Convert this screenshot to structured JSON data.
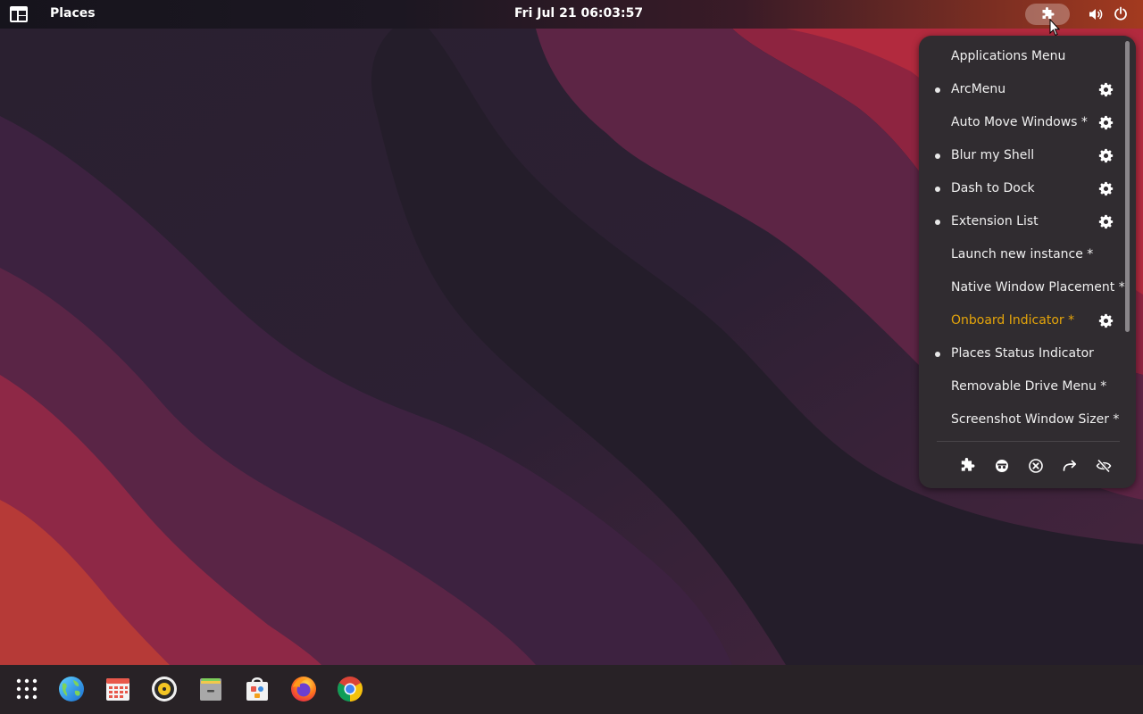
{
  "topbar": {
    "places_label": "Places",
    "clock": "Fri Jul 21  06:03:57"
  },
  "extension_menu": {
    "items": [
      {
        "label": "Applications Menu",
        "enabled": false,
        "has_settings": false,
        "highlight": false
      },
      {
        "label": "ArcMenu",
        "enabled": true,
        "has_settings": true,
        "highlight": false
      },
      {
        "label": "Auto Move Windows *",
        "enabled": false,
        "has_settings": true,
        "highlight": false
      },
      {
        "label": "Blur my Shell",
        "enabled": true,
        "has_settings": true,
        "highlight": false
      },
      {
        "label": "Dash to Dock",
        "enabled": true,
        "has_settings": true,
        "highlight": false
      },
      {
        "label": "Extension List",
        "enabled": true,
        "has_settings": true,
        "highlight": false
      },
      {
        "label": "Launch new instance *",
        "enabled": false,
        "has_settings": false,
        "highlight": false
      },
      {
        "label": "Native Window Placement *",
        "enabled": false,
        "has_settings": false,
        "highlight": false
      },
      {
        "label": "Onboard Indicator *",
        "enabled": false,
        "has_settings": true,
        "highlight": true
      },
      {
        "label": "Places Status Indicator",
        "enabled": true,
        "has_settings": false,
        "highlight": false
      },
      {
        "label": "Removable Drive Menu *",
        "enabled": false,
        "has_settings": false,
        "highlight": false
      },
      {
        "label": "Screenshot Window Sizer *",
        "enabled": false,
        "has_settings": false,
        "highlight": false
      }
    ],
    "bottom_icons": [
      "puzzle-icon",
      "incognito-icon",
      "close-circle-icon",
      "redo-arrow-icon",
      "eye-off-icon"
    ]
  },
  "dock": {
    "items": [
      "app-grid-icon",
      "web-browser-icon",
      "calendar-icon",
      "music-player-icon",
      "files-icon",
      "software-store-icon",
      "firefox-icon",
      "chrome-icon"
    ]
  },
  "colors": {
    "highlight_text": "#e5a50a",
    "popup_bg": "#302c30",
    "dock_bg": "#282226"
  }
}
